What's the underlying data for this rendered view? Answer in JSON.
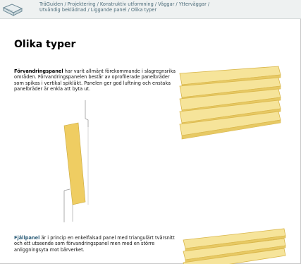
{
  "header": {
    "logo_icon": "traguiden-book-icon",
    "breadcrumb_line1": "TräGuiden / Projektering / Konstruktiv utformning / Väggar / Ytterväggar /",
    "breadcrumb_line2": "Utvändig beklädnad / Liggande panel / Olika typer"
  },
  "main": {
    "title": "Olika typer",
    "section1": {
      "term": "Förvandringspanel",
      "text": " har varit allmänt förekommande i slagregnsrika områden. Förvandringspanelen består av oprofilerade panelbräder som spikas i vertikal spikläkt. Panelen ger god luftning och enstaka panelbräder är enkla att byta ut."
    },
    "section2": {
      "term": "Fjällpanel",
      "text": " är i princip en enkelfalsad panel med triangulärt tvärsnitt och ett utseende som förvandringspanel men med en större anliggningsyta mot bärverket."
    },
    "colors": {
      "board_fill": "#f6e49a",
      "board_edge": "#d9b64a",
      "section_fill": "#efcd62",
      "link": "#2f5f7a"
    }
  }
}
